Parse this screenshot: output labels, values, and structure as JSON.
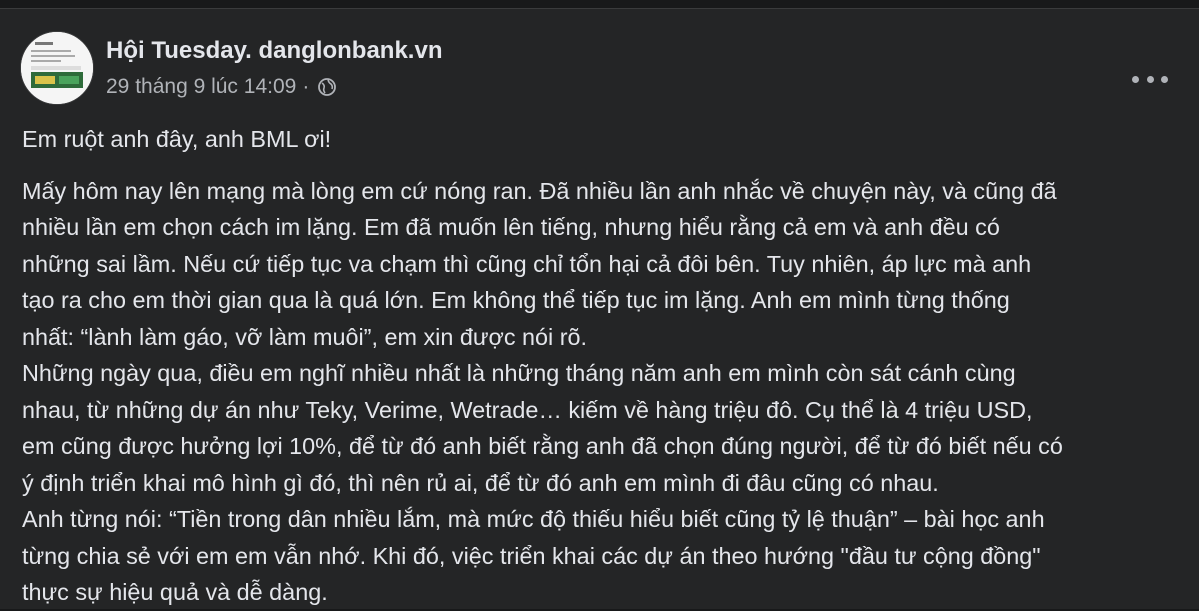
{
  "post": {
    "author": "Hội Tuesday. danglonbank.vn",
    "date": "29 tháng 9 lúc 14:09",
    "separator": "·",
    "privacy_icon": "globe-icon",
    "menu_icon": "more-options-icon",
    "greeting": "Em ruột anh đây, anh BML ơi!",
    "body_lines": [
      "Mấy hôm nay lên mạng mà lòng em cứ nóng ran. Đã nhiều lần anh nhắc về chuyện này, và cũng đã",
      "nhiều lần em chọn cách im lặng. Em đã muốn lên tiếng, nhưng hiểu rằng cả em và anh đều có",
      "những sai lầm. Nếu cứ tiếp tục va chạm thì cũng chỉ tổn hại cả đôi bên. Tuy nhiên, áp lực mà anh",
      "tạo ra cho em thời gian qua là quá lớn. Em không thể tiếp tục im lặng. Anh em mình từng thống",
      "nhất: “lành làm gáo, vỡ làm muôi”, em xin được nói rõ.",
      "Những ngày qua, điều em nghĩ nhiều nhất là những tháng năm anh em mình còn sát cánh cùng",
      "nhau, từ những dự án như Teky, Verime, Wetrade… kiếm về hàng triệu đô. Cụ thể là 4 triệu USD,",
      "em cũng được hưởng lợi 10%, để từ đó anh biết rằng anh đã chọn đúng người, để từ đó biết nếu có",
      "ý định triển khai mô hình gì đó, thì nên rủ ai, để từ đó anh em mình đi đâu cũng có nhau.",
      "Anh từng nói: “Tiền trong dân nhiều lắm, mà mức độ thiếu hiểu biết cũng tỷ lệ thuận” – bài học anh",
      "từng chia sẻ với em em vẫn nhớ. Khi đó, việc triển khai các dự án theo hướng \"đầu tư cộng đồng\"",
      "thực sự hiệu quả và dễ dàng."
    ]
  }
}
